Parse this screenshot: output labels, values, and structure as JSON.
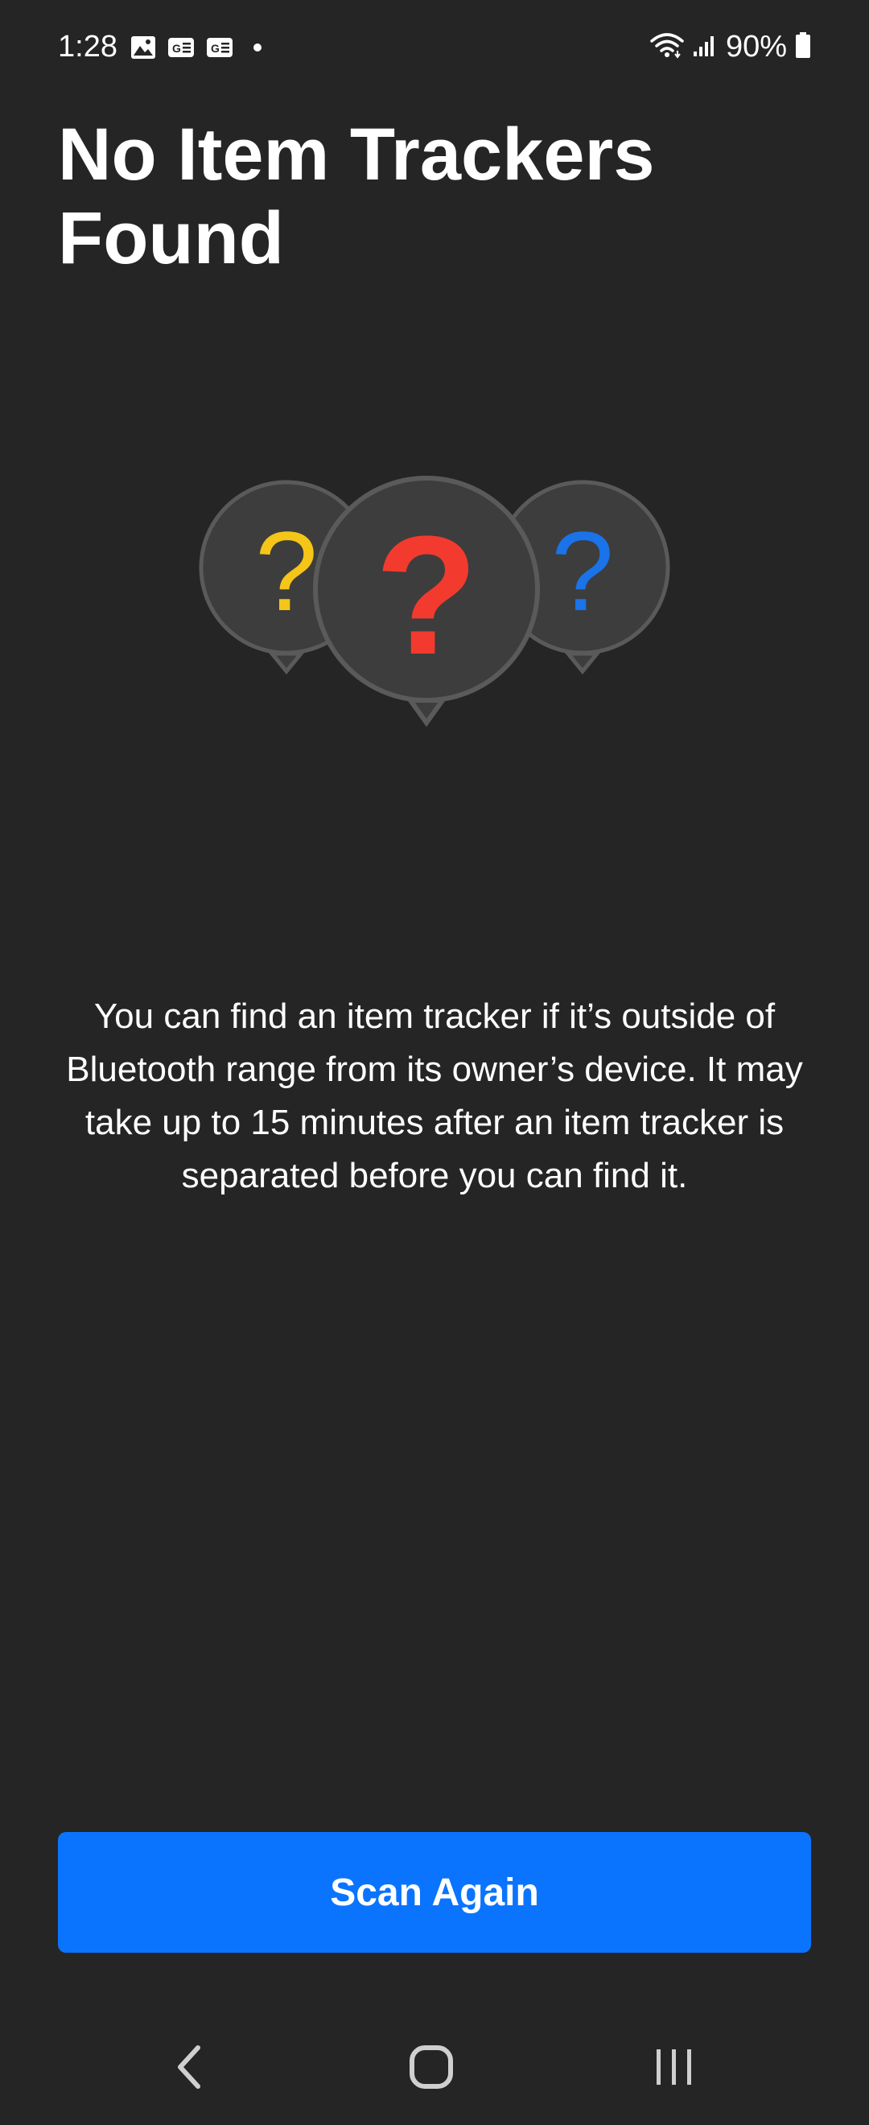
{
  "status_bar": {
    "time": "1:28",
    "notification_icons": [
      "image-icon",
      "message-icon",
      "message-icon",
      "dot-icon"
    ],
    "wifi_icon": "wifi-icon",
    "signal_icon": "signal-icon",
    "battery_percent": "90%",
    "battery_icon": "battery-icon"
  },
  "page": {
    "title": "No Item Trackers Found",
    "description": "You can find an item tracker if it’s outside of Bluetooth range from its owner’s device. It may take up to 15 minutes after an item tracker is separated before you can find it.",
    "illustration": {
      "icons": [
        "question-bubble-yellow",
        "question-bubble-red",
        "question-bubble-blue"
      ],
      "glyph": "?",
      "colors": {
        "left": "#f5c518",
        "center": "#f23a2e",
        "right": "#1a73e8",
        "bubble": "#3d3d3d",
        "bubble_border": "#5a5a5a"
      }
    }
  },
  "actions": {
    "scan_again_label": "Scan Again",
    "accent_color": "#0a74ff"
  },
  "nav_bar": {
    "back_icon": "back-chevron-icon",
    "home_icon": "home-icon",
    "recents_icon": "recents-icon"
  }
}
